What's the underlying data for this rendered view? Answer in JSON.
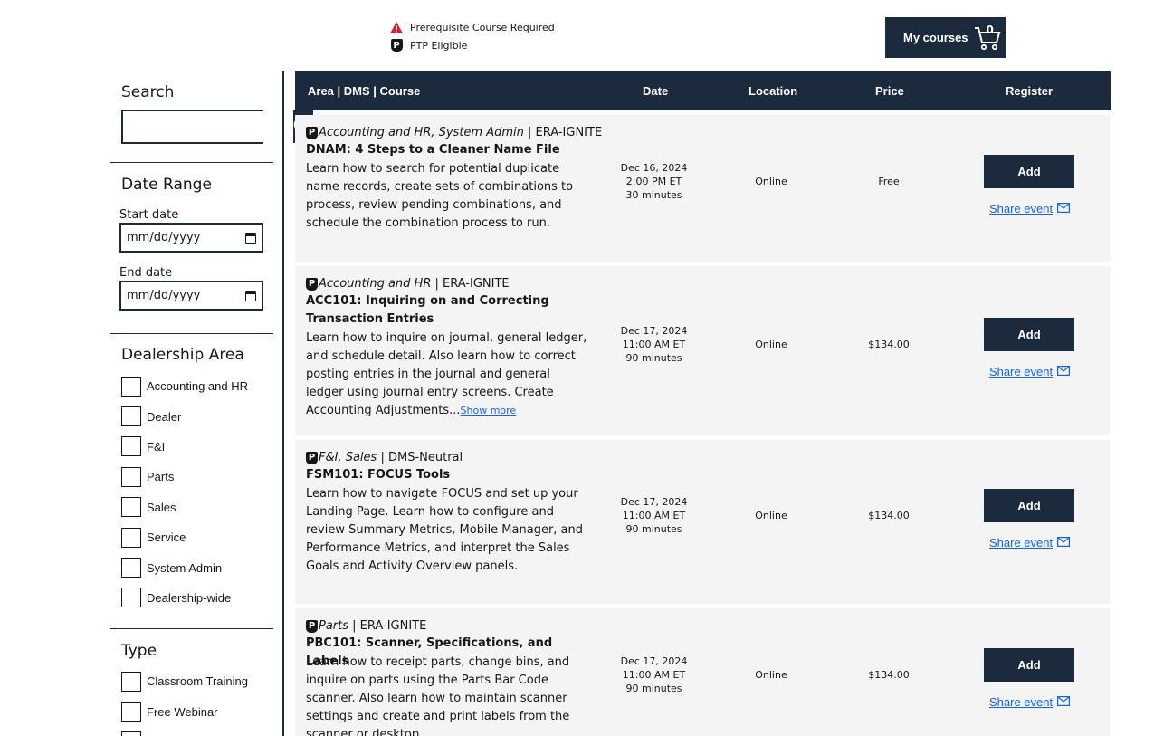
{
  "legend": {
    "prereq_label": "Prerequisite Course Required",
    "ptp_label": "PTP Eligible",
    "ptp_badge": "P",
    "prereq_icon": "warning-icon",
    "ptp_icon": "ptp-badge-icon",
    "warning_color": "#da1e28"
  },
  "header": {
    "my_courses_label": "My courses",
    "cart_count": "0",
    "cart_icon": "cart-icon"
  },
  "sidebar": {
    "search_title": "Search",
    "search_value": "",
    "date_range_title": "Date Range",
    "start_label": "Start date",
    "start_value": "mm/dd/yyyy",
    "end_label": "End date",
    "end_value": "mm/dd/yyyy",
    "dealership_title": "Dealership Area",
    "dealership_areas": [
      "Accounting and HR",
      "Dealer",
      "F&I",
      "Parts",
      "Sales",
      "Service",
      "System Admin",
      "Dealership-wide"
    ],
    "type_title": "Type",
    "types": [
      "Classroom Training",
      "Free Webinar"
    ]
  },
  "table": {
    "headers": {
      "course": "Area | DMS | Course",
      "date": "Date",
      "location": "Location",
      "price": "Price",
      "register": "Register"
    },
    "add_label": "Add",
    "share_label": "Share event",
    "show_more_label": "Show more",
    "rows": [
      {
        "badge": "P",
        "area": "Accounting and HR, System Admin",
        "dms": " | ERA-IGNITE",
        "title": "DNAM: 4 Steps to a Cleaner Name File",
        "desc": "Learn how to search for potential duplicate name records, create sets of combinations to process, review pending combinations, and schedule the combination process to run.",
        "date": "Dec 16, 2024",
        "time": "2:00 PM ET",
        "duration": "30 minutes",
        "location": "Online",
        "price": "Free"
      },
      {
        "badge": "P",
        "area": "Accounting and HR",
        "dms": " | ERA-IGNITE",
        "title": "ACC101: Inquiring on and Correcting Transaction Entries",
        "desc": "Learn how to inquire on journal, general ledger, and schedule detail. Also learn how to correct posting entries in the journal and general ledger using journal entry screens. Create Accounting Adjustments...",
        "date": "Dec 17, 2024",
        "time": "11:00 AM ET",
        "duration": "90 minutes",
        "location": "Online",
        "price": "$134.00"
      },
      {
        "badge": "P",
        "area": "F&I, Sales",
        "dms": " | DMS-Neutral",
        "title": "FSM101: FOCUS Tools",
        "desc": "Learn how to navigate FOCUS and set up your Landing Page. Learn how to configure and review Summary Metrics, Mobile Manager, and Performance Metrics, and interpret the Sales Goals and Activity Overview panels.",
        "date": "Dec 17, 2024",
        "time": "11:00 AM ET",
        "duration": "90 minutes",
        "location": "Online",
        "price": "$134.00"
      },
      {
        "badge": "P",
        "area": "Parts",
        "dms": " | ERA-IGNITE",
        "title": "PBC101: Scanner, Specifications, and Labels",
        "desc": "Learn how to receipt parts, change bins, and inquire on parts using the Parts Bar Code scanner. Also learn how to maintain scanner settings and create and print labels from the scanner or desktop.",
        "date": "Dec 17, 2024",
        "time": "11:00 AM ET",
        "duration": "90 minutes",
        "location": "Online",
        "price": "$134.00"
      }
    ]
  },
  "colors": {
    "navy": "#1b2a3d",
    "link": "#0f62fe",
    "row_bg": "#f4f4f4"
  }
}
